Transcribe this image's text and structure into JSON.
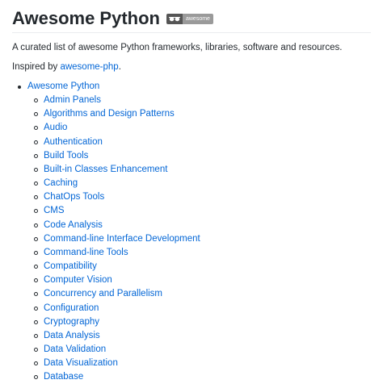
{
  "header": {
    "title": "Awesome Python",
    "badge_left_icon": "sunglasses-icon",
    "badge_text": "awesome"
  },
  "intro": {
    "description": "A curated list of awesome Python frameworks, libraries, software and resources.",
    "inspired_prefix": "Inspired by ",
    "inspired_link": "awesome-php",
    "inspired_suffix": "."
  },
  "toc": {
    "root_label": "Awesome Python",
    "items": [
      "Admin Panels",
      "Algorithms and Design Patterns",
      "Audio",
      "Authentication",
      "Build Tools",
      "Built-in Classes Enhancement",
      "Caching",
      "ChatOps Tools",
      "CMS",
      "Code Analysis",
      "Command-line Interface Development",
      "Command-line Tools",
      "Compatibility",
      "Computer Vision",
      "Concurrency and Parallelism",
      "Configuration",
      "Cryptography",
      "Data Analysis",
      "Data Validation",
      "Data Visualization",
      "Database"
    ]
  },
  "colors": {
    "link": "#0366d6",
    "text": "#24292e",
    "badge_left": "#555555",
    "badge_right": "#9a9a9a",
    "rule": "#eaecef"
  }
}
